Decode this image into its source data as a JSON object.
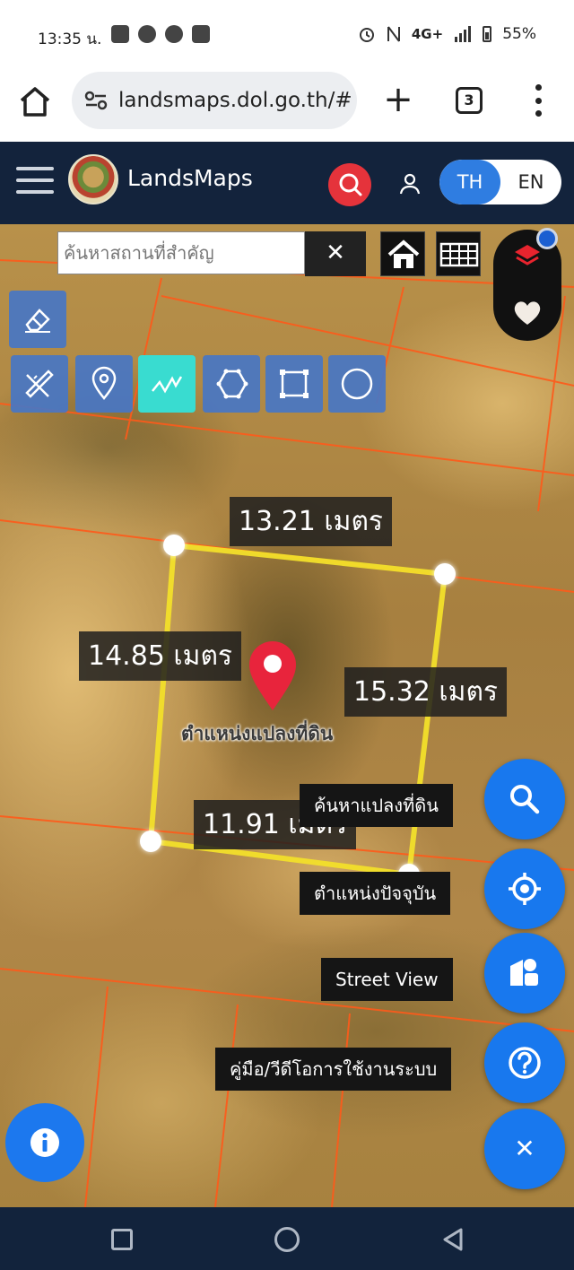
{
  "status_bar": {
    "time": "13:35 น.",
    "network": "4G+",
    "battery": "55%"
  },
  "browser": {
    "url": "landsmaps.dol.go.th/#",
    "tab_count": "3"
  },
  "app_header": {
    "app_name": "LandsMaps",
    "lang_th": "TH",
    "lang_en": "EN"
  },
  "map_search": {
    "placeholder": "ค้นหาสถานที่สำคัญ",
    "clear_symbol": "✕"
  },
  "draw_tools": {
    "items": [
      "eraser",
      "measure-tool",
      "marker",
      "polyline",
      "polygon",
      "rectangle",
      "circle"
    ],
    "active": "polyline"
  },
  "measurements": {
    "top": "13.21 เมตร",
    "left": "14.85 เมตร",
    "right": "15.32 เมตร",
    "bottom": "11.91 เมตร"
  },
  "parcel_pin_label": "ตำแหน่งแปลงที่ดิน",
  "fab_menu": {
    "search_parcel": "ค้นหาแปลงที่ดิน",
    "current_location": "ตำแหน่งปัจจุบัน",
    "street_view": "Street View",
    "manual": "คู่มือ/วีดีโอการใช้งานระบบ",
    "close_symbol": "✕"
  },
  "colors": {
    "header_bg": "#13233c",
    "accent_blue": "#1878ee",
    "active_tool": "#39dcd0",
    "parcel_outline": "#f2df2a",
    "plot_lines": "#ff5a1a",
    "pin_red": "#e8243c"
  }
}
